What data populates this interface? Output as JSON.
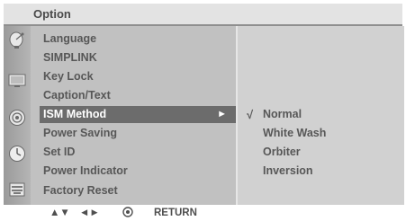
{
  "osd": {
    "title": "Option"
  },
  "sidebar": {
    "icons": [
      "satellite-dish-icon",
      "tv-picture-icon",
      "speaker-icon",
      "clock-icon",
      "keyboard-lock-icon"
    ]
  },
  "menu": {
    "items": [
      {
        "label": "Language",
        "selected": false
      },
      {
        "label": "SIMPLINK",
        "selected": false
      },
      {
        "label": "Key Lock",
        "selected": false
      },
      {
        "label": "Caption/Text",
        "selected": false
      },
      {
        "label": "ISM Method",
        "selected": true,
        "arrow": "►"
      },
      {
        "label": "Power Saving",
        "selected": false
      },
      {
        "label": "Set ID",
        "selected": false
      },
      {
        "label": "Power Indicator",
        "selected": false
      },
      {
        "label": "Factory Reset",
        "selected": false
      }
    ]
  },
  "submenu": {
    "items": [
      {
        "label": "Normal",
        "checked": true,
        "check_mark": "√"
      },
      {
        "label": "White Wash",
        "checked": false
      },
      {
        "label": "Orbiter",
        "checked": false
      },
      {
        "label": "Inversion",
        "checked": false
      }
    ]
  },
  "footer": {
    "nav_arrows_updown": "▲▼",
    "nav_arrows_leftright": "◄►",
    "ok_icon": "ok-select-icon",
    "return_label": "RETURN"
  },
  "colors": {
    "osd_background": "#c9c9c9",
    "title_background": "#e3e3e3",
    "selected_background": "#6c6c6c",
    "text": "#575757",
    "selected_text": "#ffffff"
  }
}
